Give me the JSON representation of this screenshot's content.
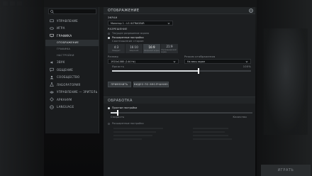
{
  "sidebar": {
    "search_placeholder": "",
    "items": [
      {
        "label": "УПРАВЛЕНИЕ",
        "icon": "keyboard-icon"
      },
      {
        "label": "ИГРА",
        "icon": "gamepad-icon"
      },
      {
        "label": "ГРАФИКА",
        "icon": "monitor-icon",
        "active": true
      },
      {
        "label": "ЗВУК",
        "icon": "speaker-icon"
      },
      {
        "label": "ОБЩЕНИЕ",
        "icon": "chat-icon"
      },
      {
        "label": "СООБЩЕСТВО",
        "icon": "people-icon"
      },
      {
        "label": "ЛАБОРАТОРИЯ",
        "icon": "flask-icon"
      },
      {
        "label": "УПРАВЛЕНИЕ — ЗРИТЕЛЬ",
        "icon": "eye-icon"
      },
      {
        "label": "АРКАНУМ",
        "icon": "arcanum-icon"
      },
      {
        "label": "LANGUAGE",
        "icon": "globe-icon"
      }
    ],
    "graphics_subitems": [
      "ОТОБРАЖЕНИЕ",
      "ГРАФИКА",
      "НАСТРОЙКИ"
    ]
  },
  "panel": {
    "title": "ОТОБРАЖЕНИЕ",
    "screen_label": "ЭКРАН",
    "monitor_value": "Монитор 1 : LG ULTRAGEAR",
    "resolution_label": "РАЗРЕШЕНИЕ",
    "option_recommended": "Текущее разрешение экрана",
    "option_advanced": "Расширенные настройки",
    "aspect_label": "Соотношение сторон",
    "ratios": [
      {
        "ratio": "4:3",
        "sub": "Квадрат",
        "selected": false
      },
      {
        "ratio": "16:10",
        "sub": "Широкий",
        "selected": false
      },
      {
        "ratio": "16:9",
        "sub": "Широкий экран",
        "selected": true
      },
      {
        "ratio": "21:9",
        "sub": "Ультраширокий экран",
        "selected": false
      }
    ],
    "size_label": "Размер",
    "size_value": "1920x1080 (144 Hz)",
    "mode_label": "Режим отображения",
    "mode_value": "На весь экран",
    "brightness_label": "Яркость",
    "brightness_value": "100%",
    "brightness_level": 0.62,
    "apply_label": "ПРИМЕНИТЬ",
    "defaults_label": "ВИДЕО ПО УМОЛЧАНИЮ"
  },
  "processing": {
    "title": "ОБРАБОТКА",
    "simple_label": "Простые настройки",
    "speed_label": "Скорость",
    "quality_label": "Качество",
    "quality_level": 0.05,
    "advanced_label": "Расширенные настройки"
  },
  "play_label": "ИГРАТЬ"
}
